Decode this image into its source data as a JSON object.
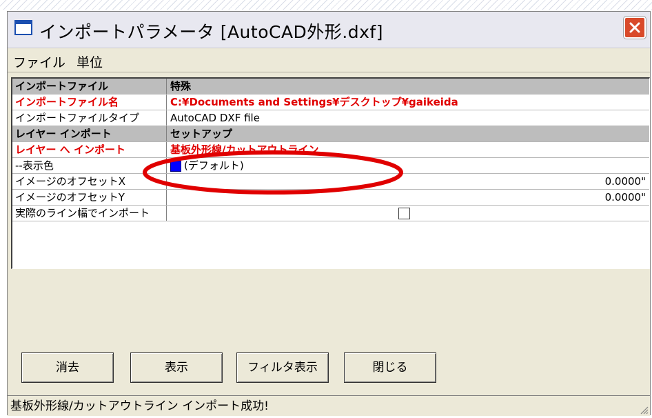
{
  "window": {
    "title": "インポートパラメータ [AutoCAD外形.dxf]"
  },
  "menu": {
    "file": "ファイル",
    "unit": "単位"
  },
  "table": {
    "header": [
      "インポートファイル",
      "特殊"
    ],
    "rows": [
      {
        "label": "インポートファイル名",
        "value": "C:¥Documents and Settings¥デスクトップ¥gaikeida"
      },
      {
        "label": "インポートファイルタイプ",
        "value": "AutoCAD DXF file"
      },
      {
        "label": "レイヤー インポート",
        "value": "セットアップ"
      },
      {
        "label": "レイヤー へ インポート",
        "value": "基板外形線/カットアウトライン"
      },
      {
        "label": "--表示色",
        "value": "(デフォルト)"
      },
      {
        "label": "イメージのオフセットX",
        "value": "0.0000\""
      },
      {
        "label": "イメージのオフセットY",
        "value": "0.0000\""
      },
      {
        "label": "実際のライン幅でインポート",
        "value": ""
      }
    ]
  },
  "buttons": {
    "clear": "消去",
    "show": "表示",
    "filter_show": "フィルタ表示",
    "close": "閉じる"
  },
  "status": "基板外形線/カットアウトライン インポート成功!",
  "colors": {
    "highlight_red": "#e00000",
    "swatch": "#0000ff",
    "annotation": "#e00000"
  }
}
